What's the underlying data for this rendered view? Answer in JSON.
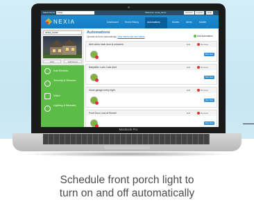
{
  "topbar": {
    "select_label": "Select Home",
    "home_value": "Patay",
    "welcome": "Welcome, nexia_home",
    "buttons": [
      "Account",
      "Logout",
      "Help"
    ]
  },
  "nav": {
    "logo": "NEXIA",
    "items": [
      "Dashboard",
      "Event History",
      "Automations",
      "Modes",
      "Alerts",
      "Mobile"
    ],
    "active": "Automations"
  },
  "sidebar": {
    "home_select": "nexia_home",
    "edit_buttons": [
      "Edit",
      "Add Home"
    ],
    "add_devices": "Add Devices",
    "items": [
      "Security & Sensors",
      "Video",
      "Lighting & Modules"
    ]
  },
  "main": {
    "title": "Automations",
    "subtitle": "Operate devices automatically.",
    "subtitle_link": "View helpful tips and videos",
    "add_automation": "Add Automation",
    "automations": [
      {
        "name": "Alert when back door is unlocked",
        "edit": "Edit",
        "remove": "Remove",
        "run": "Run Now"
      },
      {
        "name": "Babysitter Lock Code Alert",
        "edit": "Edit",
        "remove": "Remove",
        "run": "Run Now"
      },
      {
        "name": "Close garage every night",
        "edit": "Edit",
        "remove": "Remove",
        "run": "Run Now"
      },
      {
        "name": "Front Door Lock at Sunset",
        "edit": "Edit",
        "remove": "Remove",
        "run": "Run Now"
      }
    ]
  },
  "device": {
    "model": "MacBook Pro"
  },
  "caption": {
    "line1": "Schedule front porch light to",
    "line2": "turn on and off automatically"
  },
  "colors": {
    "nav_blue": "#1f8bd0",
    "sidebar_green": "#5bbd45",
    "caption_gray": "#4d4d4d"
  }
}
